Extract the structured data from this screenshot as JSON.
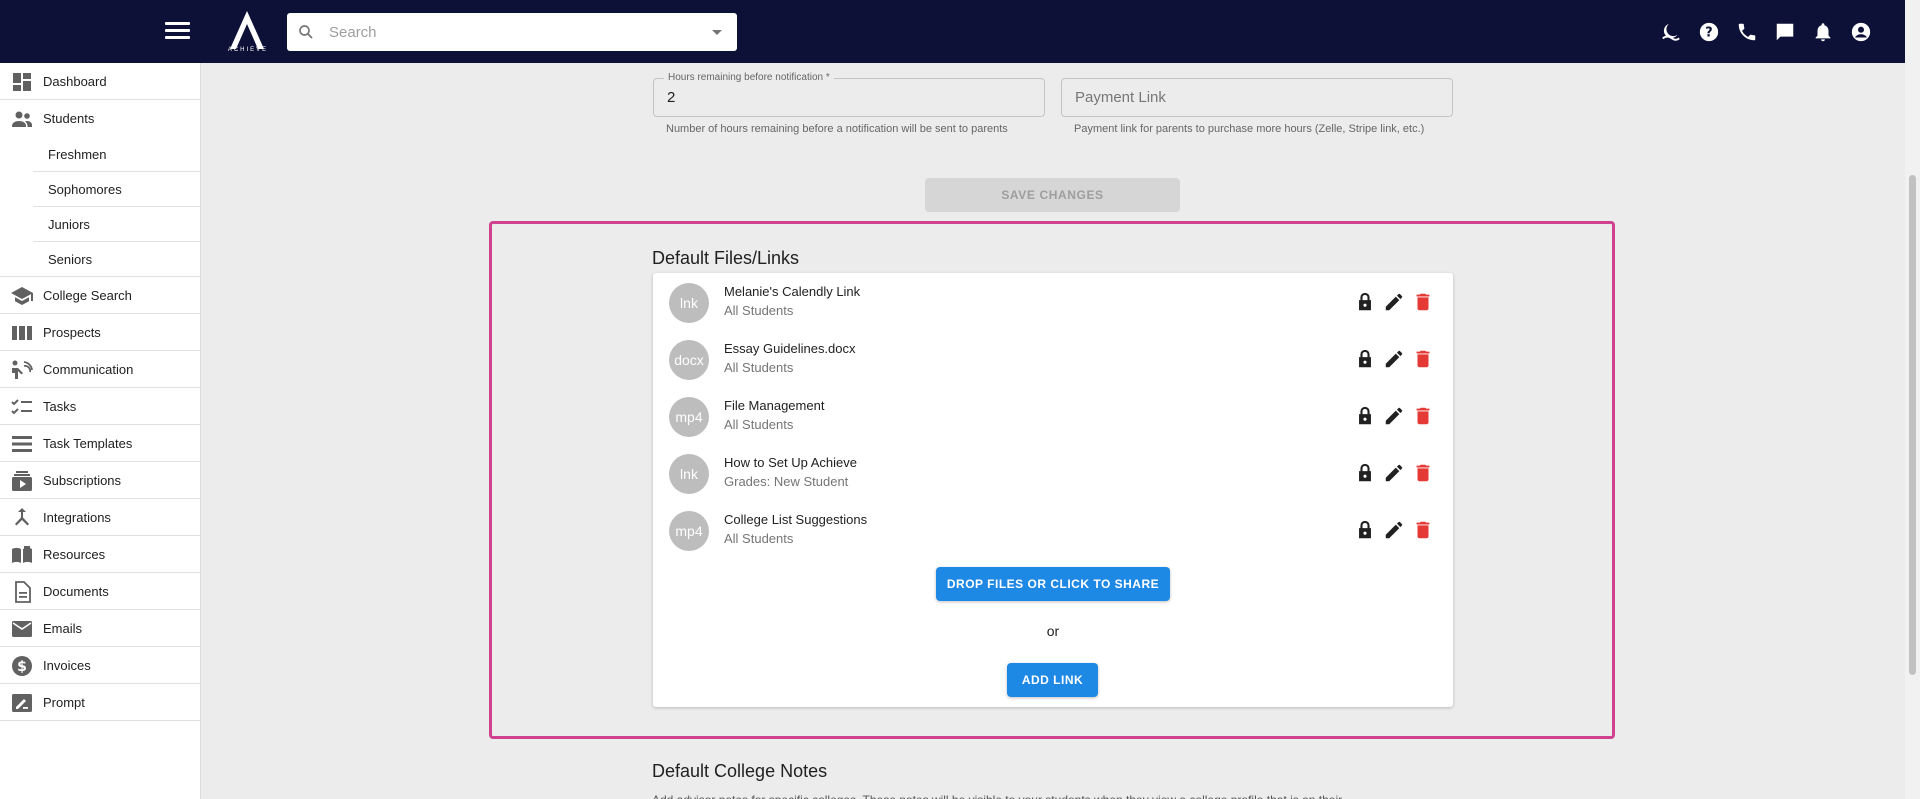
{
  "header": {
    "logo_text": "ACHIEVE",
    "search_placeholder": "Search",
    "icons": [
      "theme-toggle-icon",
      "help-icon",
      "phone-icon",
      "chat-icon",
      "bell-icon",
      "account-circle-icon"
    ]
  },
  "sidebar": {
    "items": [
      {
        "label": "Dashboard",
        "icon": "dashboard-icon"
      },
      {
        "label": "Students",
        "icon": "people-icon"
      },
      {
        "label": "Freshmen"
      },
      {
        "label": "Sophomores"
      },
      {
        "label": "Juniors"
      },
      {
        "label": "Seniors"
      },
      {
        "label": "College Search",
        "icon": "school-icon"
      },
      {
        "label": "Prospects",
        "icon": "columns-icon"
      },
      {
        "label": "Communication",
        "icon": "communication-icon"
      },
      {
        "label": "Tasks",
        "icon": "checklist-icon"
      },
      {
        "label": "Task Templates",
        "icon": "list-icon"
      },
      {
        "label": "Subscriptions",
        "icon": "subscriptions-icon"
      },
      {
        "label": "Integrations",
        "icon": "merge-icon"
      },
      {
        "label": "Resources",
        "icon": "book-icon"
      },
      {
        "label": "Documents",
        "icon": "document-icon"
      },
      {
        "label": "Emails",
        "icon": "mail-icon"
      },
      {
        "label": "Invoices",
        "icon": "dollar-icon"
      },
      {
        "label": "Prompt",
        "icon": "prompt-icon"
      }
    ]
  },
  "settings": {
    "hours_label": "Hours remaining before notification *",
    "hours_value": "2",
    "hours_helper": "Number of hours remaining before a notification will be sent to parents",
    "payment_placeholder": "Payment Link",
    "payment_helper": "Payment link for parents to purchase more hours (Zelle, Stripe link, etc.)",
    "save_label": "SAVE CHANGES"
  },
  "files": {
    "title": "Default Files/Links",
    "items": [
      {
        "type": "lnk",
        "name": "Melanie's Calendly Link",
        "audience": "All Students"
      },
      {
        "type": "docx",
        "name": "Essay Guidelines.docx",
        "audience": "All Students"
      },
      {
        "type": "mp4",
        "name": "File Management",
        "audience": "All Students"
      },
      {
        "type": "lnk",
        "name": "How to Set Up Achieve",
        "audience": "Grades: New Student"
      },
      {
        "type": "mp4",
        "name": "College List Suggestions",
        "audience": "All Students"
      }
    ],
    "drop_label": "DROP FILES OR CLICK TO SHARE",
    "or_label": "or",
    "add_link_label": "ADD LINK"
  },
  "notes": {
    "title": "Default College Notes",
    "description": "Add advisor notes for specific colleges. These notes will be visible to your students when they view a college profile that is on their"
  },
  "colors": {
    "header_bg": "#0d1137",
    "primary": "#1e88e5",
    "highlight": "#d0428f",
    "delete": "#e53935"
  }
}
